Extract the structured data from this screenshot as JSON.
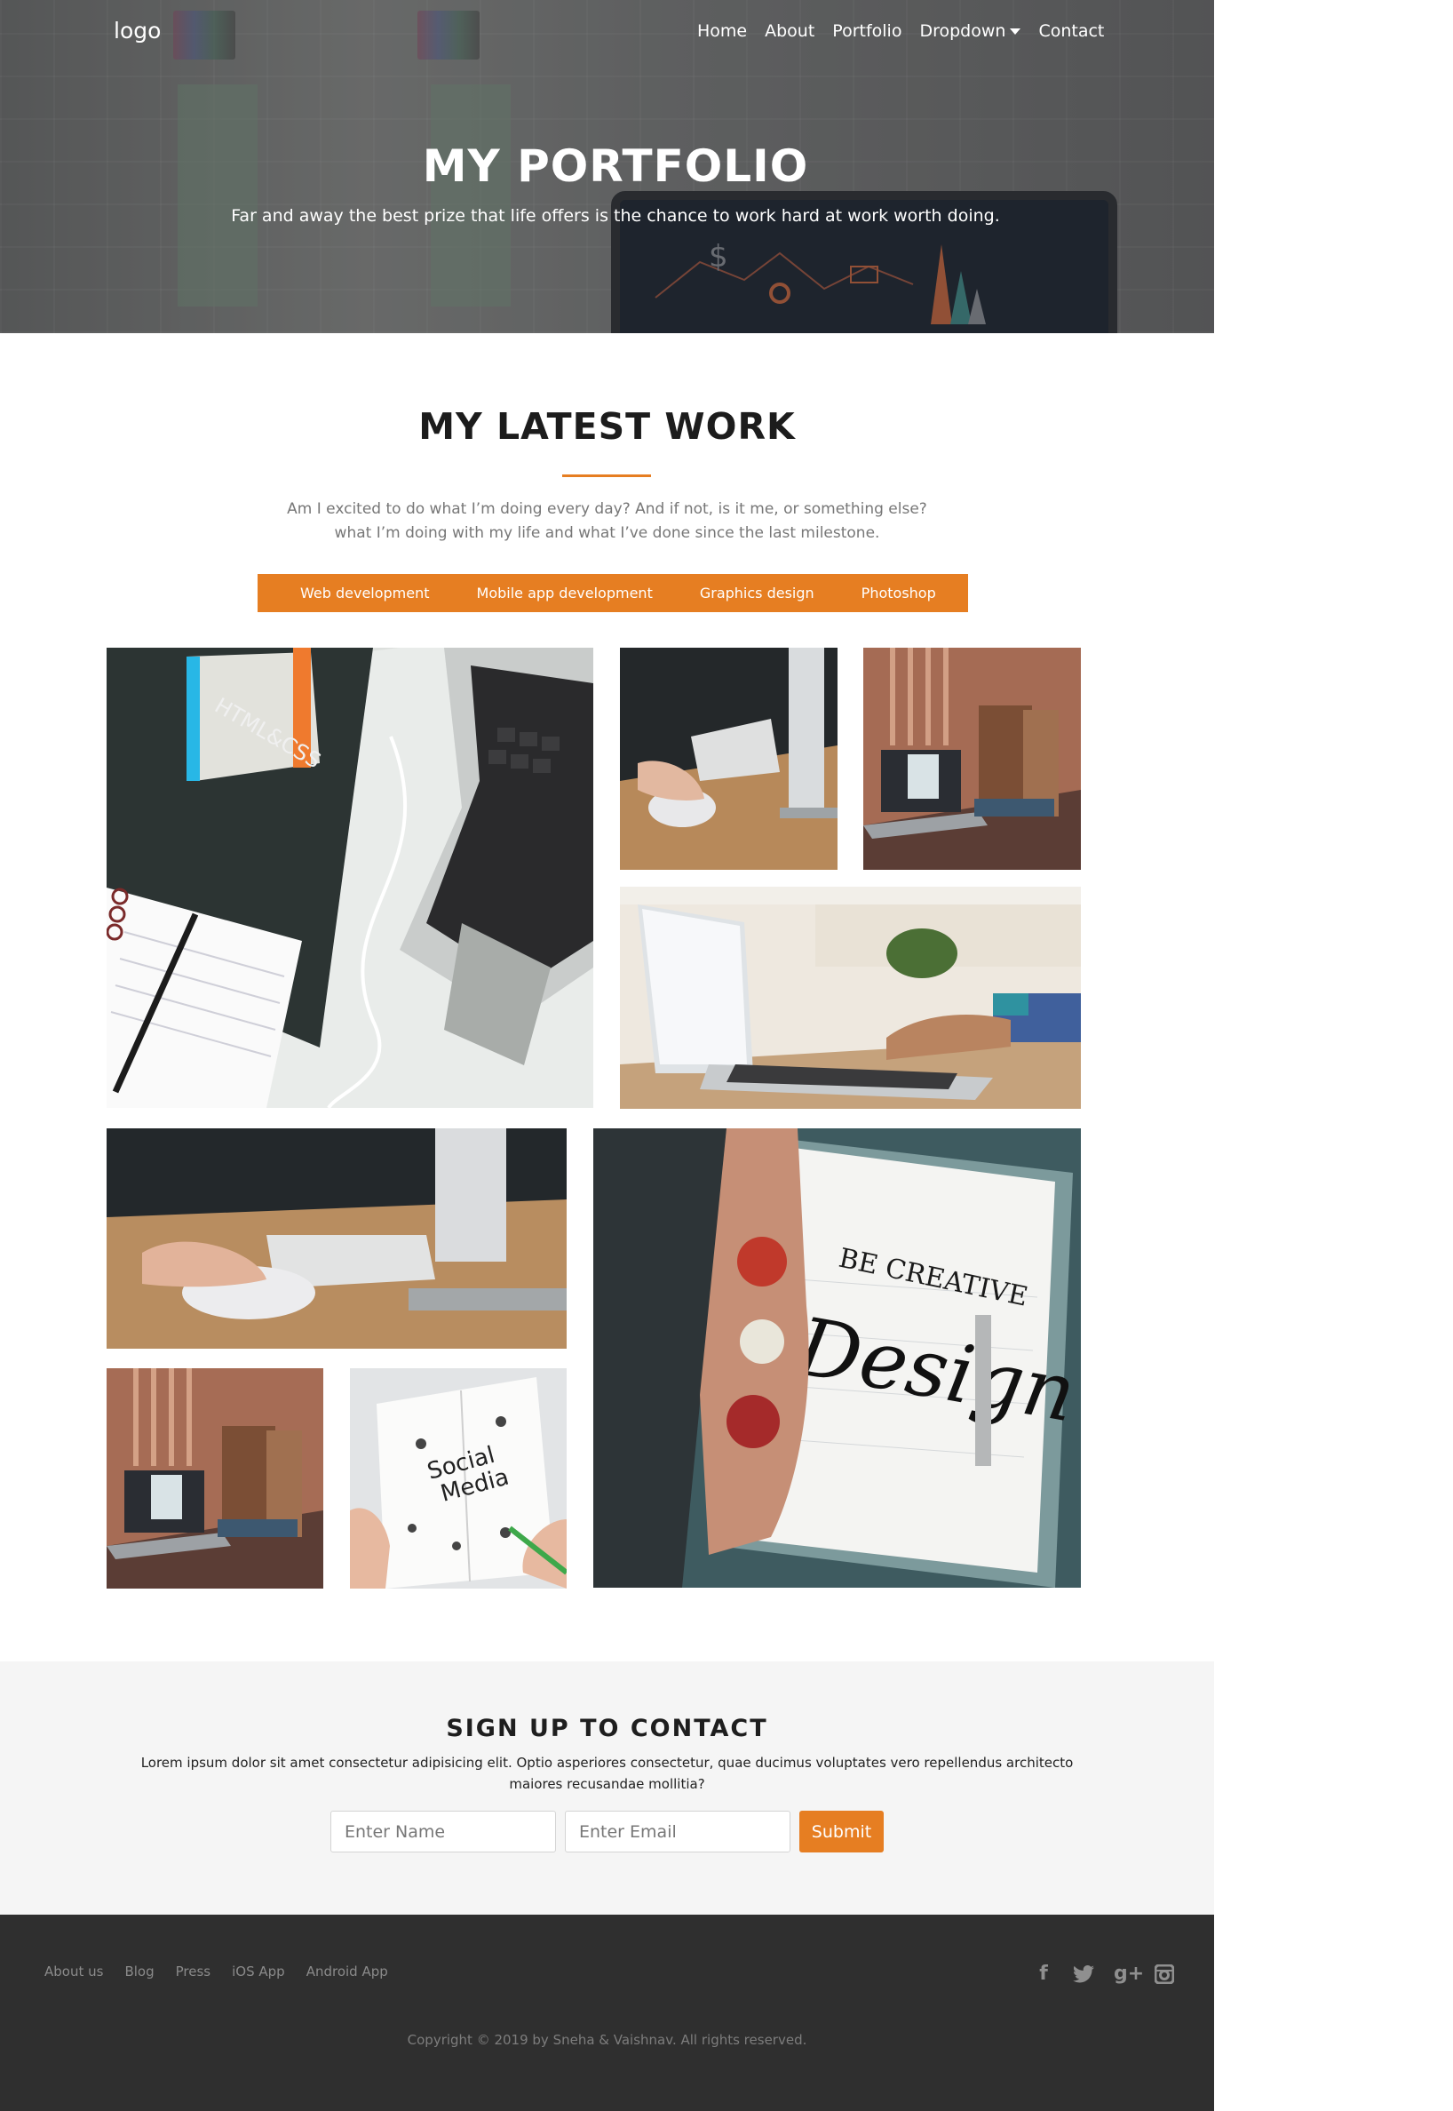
{
  "nav": {
    "logo": "logo",
    "items": [
      "Home",
      "About",
      "Portfolio",
      "Dropdown",
      "Contact"
    ]
  },
  "hero": {
    "title": "MY PORTFOLIO",
    "subtitle": "Far and away the best prize that life offers is the chance to work hard at work worth doing."
  },
  "work": {
    "title": "MY LATEST WORK",
    "description_line1": "Am I excited to do what I’m doing every day? And if not, is it me, or something else?",
    "description_line2": "what I’m doing with my life and what I’ve done since the last milestone.",
    "filters": [
      "Web development",
      "Mobile app development",
      "Graphics design",
      "Photoshop"
    ],
    "tiles": [
      "html-css-book-laptop",
      "hand-on-mouse",
      "laptop-on-desk",
      "typing-on-laptop",
      "hand-on-mouse-wide",
      "be-creative-design",
      "laptop-on-desk-small",
      "social-media-notebook"
    ],
    "tile_text": {
      "book_title": "HTML&CSS",
      "design_banner": "BE CREATIVE",
      "design_word": "Design",
      "notebook_line1": "Social",
      "notebook_line2": "Media"
    }
  },
  "signup": {
    "title": "SIGN UP TO CONTACT",
    "text": "Lorem ipsum dolor sit amet consectetur adipisicing elit. Optio asperiores consectetur, quae ducimus voluptates vero repellendus architecto maiores recusandae mollitia?",
    "name_placeholder": "Enter Name",
    "email_placeholder": "Enter Email",
    "submit_label": "Submit"
  },
  "footer": {
    "links": [
      "About us",
      "Blog",
      "Press",
      "iOS App",
      "Android App"
    ],
    "social": [
      "facebook-icon",
      "twitter-icon",
      "google-plus-icon",
      "instagram-icon"
    ],
    "social_labels": {
      "facebook": "f",
      "google_plus": "g+"
    },
    "copyright": "Copyright © 2019 by Sneha & Vaishnav. All rights reserved."
  },
  "colors": {
    "accent": "#e67e22",
    "footer_bg": "#2f2f2f",
    "signup_bg": "#f5f5f5"
  }
}
